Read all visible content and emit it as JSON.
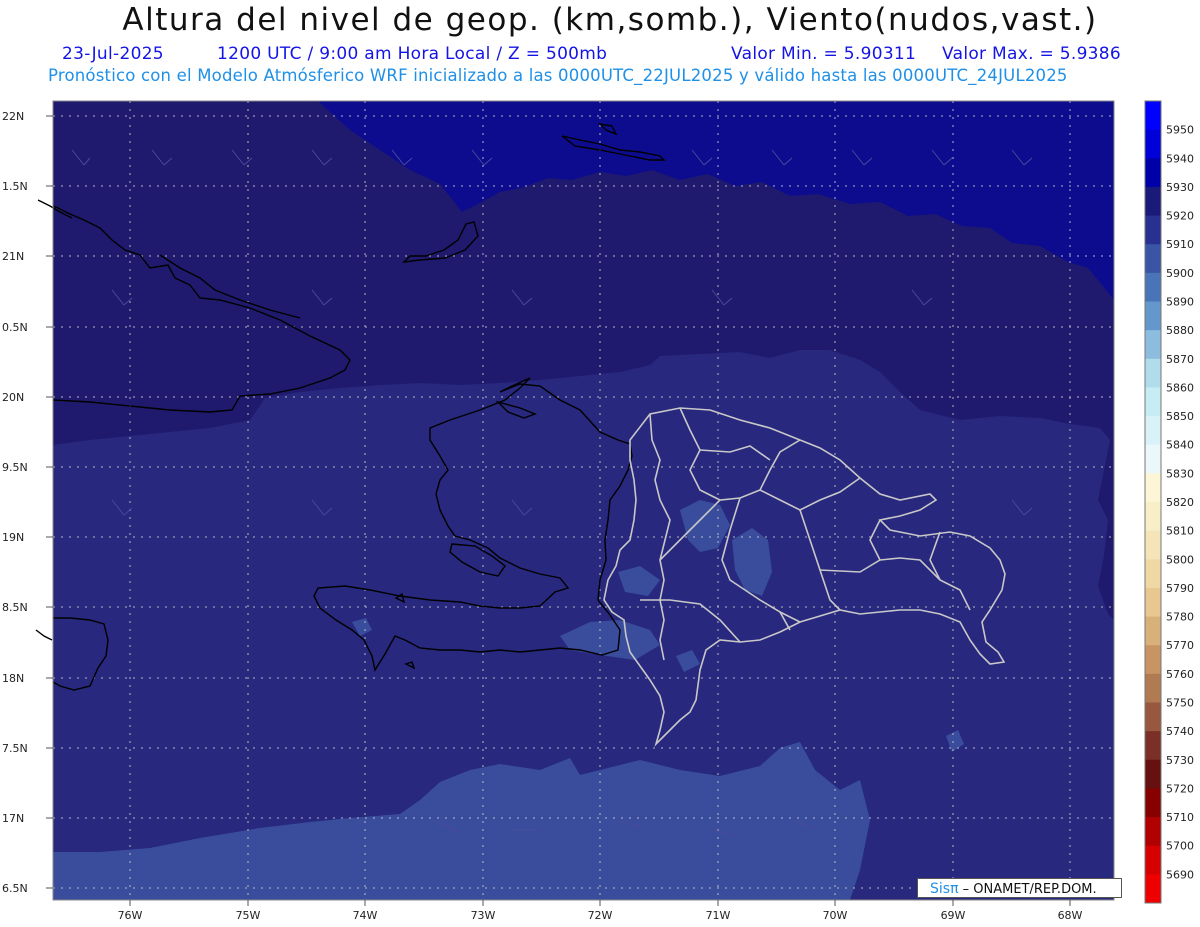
{
  "header": {
    "title": "Altura del nivel de geop. (km,somb.), Viento(nudos,vast.)",
    "valid_date": "23-Jul-2025",
    "time_info": "1200 UTC / 9:00 am Hora Local / Z = 500mb",
    "min_value": "Valor Min. = 5.90311",
    "max_value": "Valor Max. = 5.9386",
    "model_info": "Pronóstico con el Modelo Atmósferico WRF inicializado a las 0000UTC_22JUL2025 y válido hasta las  0000UTC_24JUL2025"
  },
  "map": {
    "lat_labels": [
      "22N",
      "1.5N",
      "21N",
      "0.5N",
      "20N",
      "9.5N",
      "19N",
      "8.5N",
      "18N",
      "7.5N",
      "17N",
      "6.5N"
    ],
    "lon_labels": [
      "76W",
      "75W",
      "74W",
      "73W",
      "72W",
      "71W",
      "70W",
      "69W",
      "68W"
    ],
    "field_colors": {
      "deep": "#0d0c8e",
      "main": "#1f1a6e",
      "mid": "#27287e",
      "light": "#3a4d9c",
      "lighter": "#4868b0"
    }
  },
  "colorbar": {
    "levels": [
      "5950",
      "5940",
      "5930",
      "5920",
      "5910",
      "5900",
      "5890",
      "5880",
      "5870",
      "5860",
      "5850",
      "5840",
      "5830",
      "5820",
      "5810",
      "5800",
      "5790",
      "5780",
      "5770",
      "5760",
      "5750",
      "5740",
      "5730",
      "5720",
      "5710",
      "5700",
      "5690"
    ],
    "colors": [
      "#0000ff",
      "#0000d8",
      "#0000a8",
      "#1a1a78",
      "#283090",
      "#3a54a6",
      "#4a74b8",
      "#6498cc",
      "#8cbcde",
      "#b0dcec",
      "#c6ecf4",
      "#d8f2f8",
      "#eaf8fc",
      "#fcf6d6",
      "#f8eec8",
      "#f4e4b8",
      "#f0d8a4",
      "#e8c890",
      "#d8b07a",
      "#c89464",
      "#b07a52",
      "#985840",
      "#7a3026",
      "#661010",
      "#860000",
      "#b00000",
      "#d60000",
      "#ee0000"
    ]
  },
  "credit": {
    "logo": "Sisπ",
    "text": "– ONAMET/REP.DOM."
  }
}
